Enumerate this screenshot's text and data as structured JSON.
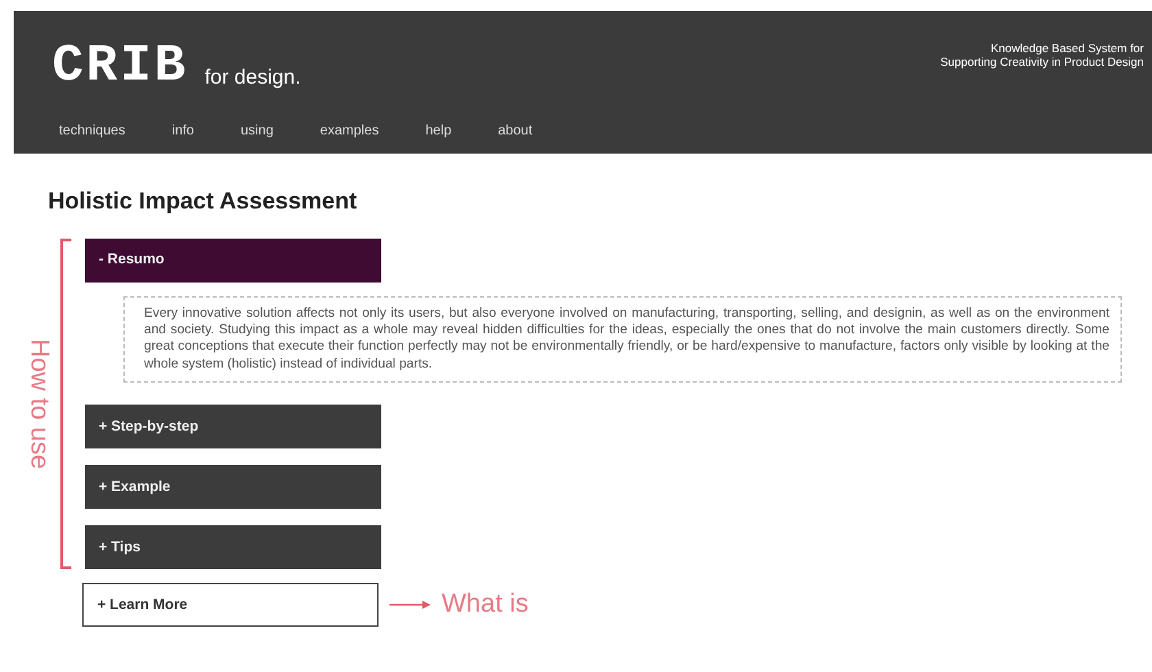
{
  "header": {
    "logo": "CRIB",
    "logo_tagline": "for design.",
    "subtitle_lines": [
      "Knowledge Based System for",
      "Supporting Creativity in Product Design"
    ],
    "nav": [
      {
        "label": "techniques"
      },
      {
        "label": "info"
      },
      {
        "label": "using"
      },
      {
        "label": "examples"
      },
      {
        "label": "help"
      },
      {
        "label": "about"
      }
    ]
  },
  "page_title": "Holistic Impact Assessment",
  "side_annotation": "How to use",
  "sections": [
    {
      "kind": "accordion",
      "sign": "-",
      "label": "Resumo",
      "expanded": true,
      "body": "Every innovative solution affects not only its users, but also everyone involved on manufacturing, transporting, selling, and designin, as well as on the environment and society. Studying this impact as a whole may reveal hidden difficulties for the ideas, especially the ones that do not involve the main customers directly. Some great conceptions that execute their function perfectly may not be environmentally friendly, or be hard/expensive to manufacture, factors only visible by looking at the whole system (holistic) instead of individual parts."
    },
    {
      "kind": "accordion",
      "sign": "+",
      "label": "Step-by-step",
      "expanded": false
    },
    {
      "kind": "accordion",
      "sign": "+",
      "label": "Example",
      "expanded": false
    },
    {
      "kind": "accordion",
      "sign": "+",
      "label": "Tips",
      "expanded": false
    },
    {
      "kind": "outline",
      "sign": "+",
      "label": "Learn More",
      "expanded": false,
      "annotation": "What is"
    }
  ]
}
